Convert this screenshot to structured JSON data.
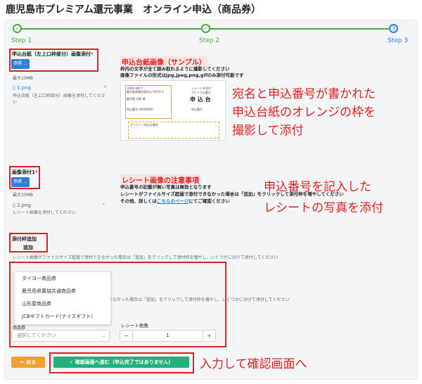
{
  "header": {
    "title": "鹿児島市プレミアム還元事業　オンライン申込（商品券）"
  },
  "steps": [
    {
      "label": "Step 1",
      "mark": "✓"
    },
    {
      "label": "Step 2",
      "mark": "✓"
    },
    {
      "label": "Step 3",
      "mark": "3"
    }
  ],
  "upload1": {
    "label": "申込台紙（左上口枠部分）画像添付",
    "required": "*",
    "button": "参照 ...",
    "max_size": "最大10MB",
    "file_name": "1.png",
    "remove": "×",
    "note": "申込台紙（左上口枠部分）画像を添付してください"
  },
  "sample1": {
    "title": "申込台紙画像（サンプル）",
    "lines": [
      "枠内の文字が全て読み取れるように撮影してください",
      "画像ファイルの形式はjpg,jpeg,png,gifのみ添付可能です"
    ],
    "card_texts": [
      "〒892-8677",
      "鹿児島県鹿児島市山下町11-1",
      "鹿児島 太郎 様",
      "申込番号 00000000",
      "レシートを添付",
      "プレミアム還元",
      "申 込 台",
      "申込番号",
      "オンライン申込の場合"
    ]
  },
  "annotation1": "宛名と申込番号が書かれた\n申込台紙のオレンジの枠を\n撮影して添付",
  "upload2": {
    "label": "画像添付1",
    "required": "*",
    "button": "参照 ...",
    "max_size": "最大10MB",
    "file_name": "2.png",
    "check": "✓",
    "note": "レシート画像を添付してください"
  },
  "sample2": {
    "title": "レシート画像の注意事項",
    "line1": "申込番号の記載が無い写真は無効となります",
    "line2": "レシートがファイルサイズ超過で添付できなかった場合は「追加」をクリックして添付枠を増やしてください",
    "line3_pre": "その他、詳しくは",
    "line3_link": "こちらのページ",
    "line3_post": "にてご確認ください"
  },
  "annotation2": "申込番号を記入した\nレシートの写真を添付",
  "add_frame": {
    "label": "添付枠追加",
    "button": "追加",
    "note": "レシート画像がファイルサイズ超過で添付できなかった場合は「追加」をクリックして添付枠を増やし、いくつかに分けて添付してください",
    "note2": "きなかった場合は「追加」をクリックして添付枠を増やし、いくつかに分けて添付してください"
  },
  "dropdown": {
    "options": [
      "タイヨー商品券",
      "鹿児島県農協共通商品券",
      "山形屋商品券",
      "JCBギフトカード(ナイスギフト)"
    ],
    "field_label": "商品券",
    "placeholder": "選択してください"
  },
  "receipt_count": {
    "label": "レシート枚数",
    "value": "1",
    "minus": "−",
    "plus": "+"
  },
  "actions": {
    "back": "戻る",
    "confirm": "確認画面へ進む（申込完了ではありません）",
    "back_icon": "←",
    "confirm_icon": "✓"
  },
  "annotation3": "入力して確認画面へ"
}
